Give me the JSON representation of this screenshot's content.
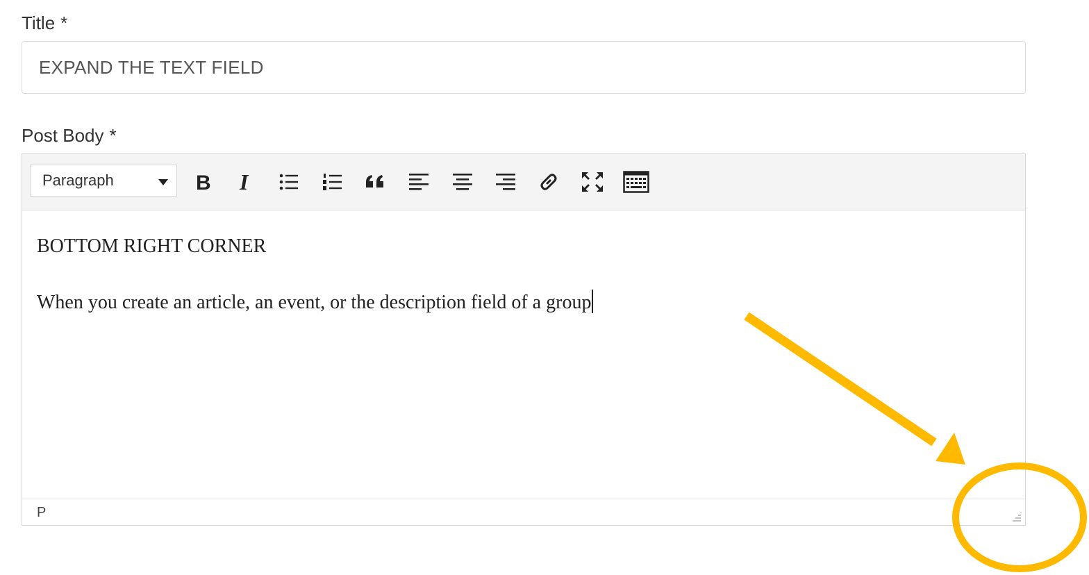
{
  "title_field": {
    "label": "Title",
    "required_marker": "*",
    "value": "EXPAND THE TEXT FIELD"
  },
  "post_body": {
    "label": "Post Body",
    "required_marker": "*",
    "toolbar": {
      "format_value": "Paragraph",
      "buttons": [
        "bold-icon",
        "italic-icon",
        "bullet-list-icon",
        "numbered-list-icon",
        "blockquote-icon",
        "align-left-icon",
        "align-center-icon",
        "align-right-icon",
        "link-icon",
        "fullscreen-icon",
        "toolbar-toggle-icon"
      ]
    },
    "content": {
      "paragraph_1": "BOTTOM RIGHT CORNER",
      "paragraph_2": "When you create an article, an event, or the description field of a group"
    },
    "status_path": "P"
  },
  "annotation": {
    "color": "#FFBA00"
  }
}
